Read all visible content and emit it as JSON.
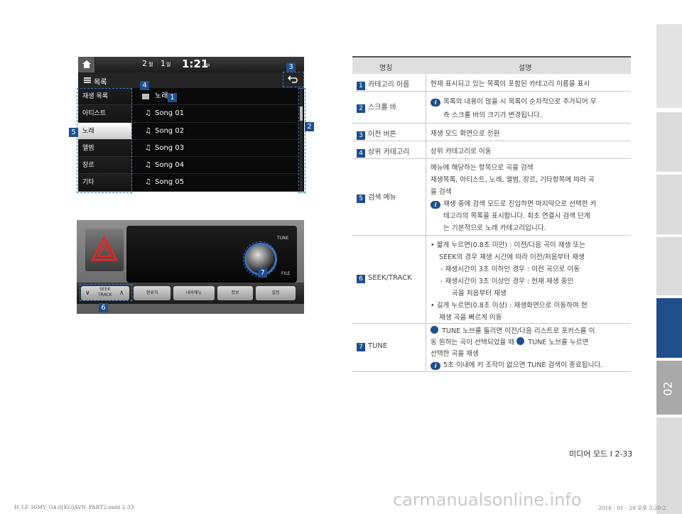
{
  "chapter_tab": "02",
  "screen": {
    "status_left": "2",
    "status_left_unit": "월",
    "status_mid": "1",
    "status_mid_unit": "일",
    "clock": "1:21",
    "ampm": "AM",
    "list_title": "목록",
    "folder_name": "노래",
    "categories": [
      "재생 목록",
      "아티스트",
      "노래",
      "앨범",
      "장르",
      "기타"
    ],
    "selected_category": "노래",
    "songs": [
      "Song 01",
      "Song 02",
      "Song 03",
      "Song 04",
      "Song 05"
    ],
    "callouts": [
      "1",
      "2",
      "3",
      "4",
      "5"
    ]
  },
  "console": {
    "tune_label": "TUNE",
    "file_label": "FILE",
    "seek_label_1": "SEEK",
    "seek_label_2": "TRACK",
    "buttons": [
      "현위치",
      "내비메뉴",
      "정보",
      "설정"
    ],
    "callouts": [
      "6",
      "7"
    ]
  },
  "table": {
    "header_name": "명칭",
    "header_desc": "설명",
    "rows": [
      {
        "num": "1",
        "name": "카테고리 이름",
        "lines": [
          "현재 표시되고 있는 목록이 포함된 카테고리 이름을 표시"
        ]
      },
      {
        "num": "2",
        "name": "스크롤 바",
        "lines": [
          "목록의 내용이 많을 시 목록이 순차적으로 추가되어 우",
          "측 스크롤 바의 크기가 변경됩니다."
        ]
      },
      {
        "num": "3",
        "name": "이전 버튼",
        "lines": [
          "재생 모드 화면으로 전환"
        ]
      },
      {
        "num": "4",
        "name": "상위 카테고리",
        "lines": [
          "상위 카테고리로 이동"
        ]
      },
      {
        "num": "5",
        "name": "검색 메뉴",
        "lines": [
          "메뉴에 해당하는 항목으로 곡을 검색",
          "재생목록, 아티스트, 노래, 앨범, 장르, 기타항목에 따라 곡",
          "을 검색",
          "재생 중에 검색 모드로 진입하면 마지막으로 선택한 카",
          "테고리의 목록을 표시합니다. 최초 연결시 검색 단계",
          "는 기본적으로 노래 카테고리입니다."
        ]
      },
      {
        "num": "6",
        "name": "SEEK/TRACK",
        "lines": [
          "• 짧게 누르면(0.8초 미만) : 이전/다음 곡이 재생 또는",
          "SEEK의 경우 재생 시간에 따라 이전/처음부터 재생",
          "- 재생시간이 3초 이하인 경우 : 이전 곡으로 이동",
          "- 재생시간이 3초 이상인 경우 : 현재 재생 중인",
          "곡을 처음부터 재생",
          "• 길게 누르면(0.8초 이상) : 재생화면으로 이동하여 현",
          "재생 곡을 빠르게 이동"
        ]
      },
      {
        "num": "7",
        "name": "TUNE",
        "lines": [
          "TUNE 노브를 돌리면 이전/다음 리스트로 포커스를 이",
          "동 원하는 곡이 선택되었을 때",
          "TUNE 노브를 누르면",
          "선택한 곡을 재생",
          "5초 이내에 키 조작이 없으면 TUNE 검색이 종료됩니다."
        ]
      }
    ],
    "info_badge": "i"
  },
  "footer": "미디어 모드 I 2-33",
  "print_line": "H_LF 16MY_G4.0[KO]AVN_PART2.indd   2-33",
  "print_line_right": "2016 - 01 - 29   오후 3:20:2",
  "watermark": "carmanualsonline.info"
}
